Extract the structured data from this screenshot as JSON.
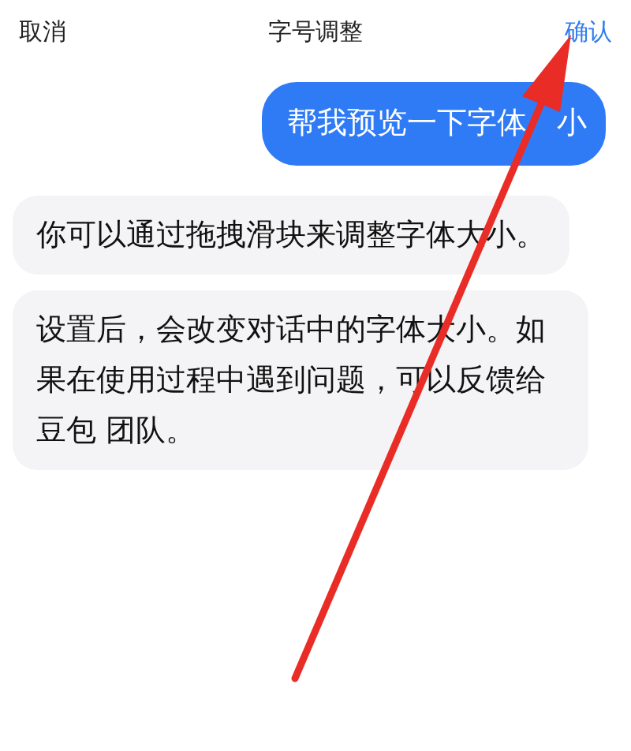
{
  "header": {
    "cancel": "取消",
    "title": "字号调整",
    "confirm": "确认"
  },
  "messages": [
    {
      "kind": "user",
      "text": "帮我预览一下字体",
      "text_after_arrow": "小"
    },
    {
      "kind": "bot",
      "text": "你可以通过拖拽滑块来调整字体大小。"
    },
    {
      "kind": "bot",
      "text": "设置后，会改变对话中的字体大小。如果在使用过程中遇到问题，可以反馈给豆包 团队。"
    }
  ]
}
